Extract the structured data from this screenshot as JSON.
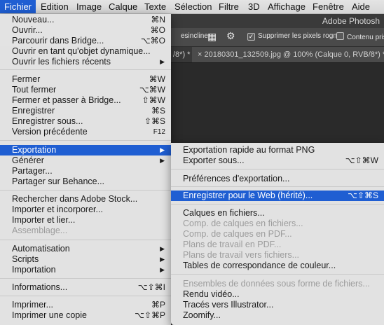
{
  "menubar": {
    "items": [
      "Fichier",
      "Edition",
      "Image",
      "Calque",
      "Texte",
      "Sélection",
      "Filtre",
      "3D",
      "Affichage",
      "Fenêtre",
      "Aide"
    ]
  },
  "app": {
    "title": "Adobe Photosh",
    "options": {
      "left_text": "esincliner",
      "check1_label": "Supprimer les pixels rognés",
      "check2_label": "Contenu pris e"
    },
    "tabs": {
      "prev_tab": "/8*) *",
      "doc_tab": "20180301_132509.jpg @ 100% (Calque 0, RVB/8*) *",
      "close_glyph": "×"
    }
  },
  "file_menu": {
    "items": [
      {
        "label": "Nouveau...",
        "shortcut": "⌘N"
      },
      {
        "label": "Ouvrir...",
        "shortcut": "⌘O"
      },
      {
        "label": "Parcourir dans Bridge...",
        "shortcut": "⌥⌘O"
      },
      {
        "label": "Ouvrir en tant qu'objet dynamique...",
        "shortcut": ""
      },
      {
        "label": "Ouvrir les fichiers récents",
        "shortcut": ""
      },
      {
        "label": "Fermer",
        "shortcut": "⌘W"
      },
      {
        "label": "Tout fermer",
        "shortcut": "⌥⌘W"
      },
      {
        "label": "Fermer et passer à Bridge...",
        "shortcut": "⇧⌘W"
      },
      {
        "label": "Enregistrer",
        "shortcut": "⌘S"
      },
      {
        "label": "Enregistrer sous...",
        "shortcut": "⇧⌘S"
      },
      {
        "label": "Version précédente",
        "shortcut": "F12"
      },
      {
        "label": "Exportation",
        "shortcut": ""
      },
      {
        "label": "Générer",
        "shortcut": ""
      },
      {
        "label": "Partager...",
        "shortcut": ""
      },
      {
        "label": "Partager sur Behance...",
        "shortcut": ""
      },
      {
        "label": "Rechercher dans Adobe Stock...",
        "shortcut": ""
      },
      {
        "label": "Importer et incorporer...",
        "shortcut": ""
      },
      {
        "label": "Importer et lier...",
        "shortcut": ""
      },
      {
        "label": "Assemblage...",
        "shortcut": ""
      },
      {
        "label": "Automatisation",
        "shortcut": ""
      },
      {
        "label": "Scripts",
        "shortcut": ""
      },
      {
        "label": "Importation",
        "shortcut": ""
      },
      {
        "label": "Informations...",
        "shortcut": "⌥⇧⌘I"
      },
      {
        "label": "Imprimer...",
        "shortcut": "⌘P"
      },
      {
        "label": "Imprimer une copie",
        "shortcut": "⌥⇧⌘P"
      }
    ],
    "submenu_arrow": "▶"
  },
  "export_menu": {
    "items": [
      {
        "label": "Exportation rapide au format PNG",
        "shortcut": ""
      },
      {
        "label": "Exporter sous...",
        "shortcut": "⌥⇧⌘W"
      },
      {
        "label": "Préférences d'exportation...",
        "shortcut": ""
      },
      {
        "label": "Enregistrer pour le Web (hérité)...",
        "shortcut": "⌥⇧⌘S"
      },
      {
        "label": "Calques en fichiers...",
        "shortcut": ""
      },
      {
        "label": "Comp. de calques en fichiers...",
        "shortcut": ""
      },
      {
        "label": "Comp. de calques en PDF...",
        "shortcut": ""
      },
      {
        "label": "Plans de travail en PDF...",
        "shortcut": ""
      },
      {
        "label": "Plans de travail vers fichiers...",
        "shortcut": ""
      },
      {
        "label": "Tables de correspondance de couleur...",
        "shortcut": ""
      },
      {
        "label": "Ensembles de données sous forme de fichiers...",
        "shortcut": ""
      },
      {
        "label": "Rendu vidéo...",
        "shortcut": ""
      },
      {
        "label": "Tracés vers Illustrator...",
        "shortcut": ""
      },
      {
        "label": "Zoomify...",
        "shortcut": ""
      }
    ]
  },
  "colors": {
    "highlight": "#1f5ed2",
    "disabled_text": "#9c9c9c"
  }
}
